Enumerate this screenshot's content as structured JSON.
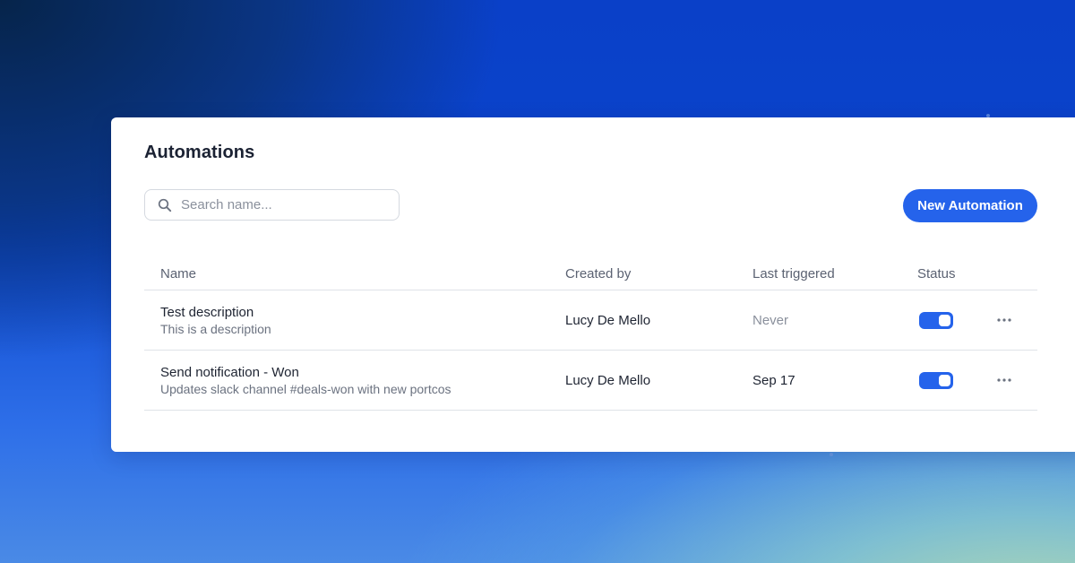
{
  "page": {
    "title": "Automations"
  },
  "search": {
    "placeholder": "Search name...",
    "value": ""
  },
  "actions": {
    "new_automation_label": "New Automation"
  },
  "table": {
    "columns": [
      "Name",
      "Created by",
      "Last triggered",
      "Status"
    ],
    "rows": [
      {
        "name": "Test description",
        "description": "This is a description",
        "created_by": "Lucy De Mello",
        "last_triggered": "Never",
        "status_enabled": true
      },
      {
        "name": "Send notification - Won",
        "description": "Updates slack channel #deals-won with new portcos",
        "created_by": "Lucy De Mello",
        "last_triggered": "Sep 17",
        "status_enabled": true
      }
    ]
  },
  "colors": {
    "accent": "#2563eb",
    "text_primary": "#1e2432",
    "text_secondary": "#6b7280",
    "background_gradient_start": "#06244a",
    "background_gradient_end": "#bfe0ae"
  },
  "icons": {
    "search": "search-icon",
    "more": "more-horizontal-icon"
  }
}
